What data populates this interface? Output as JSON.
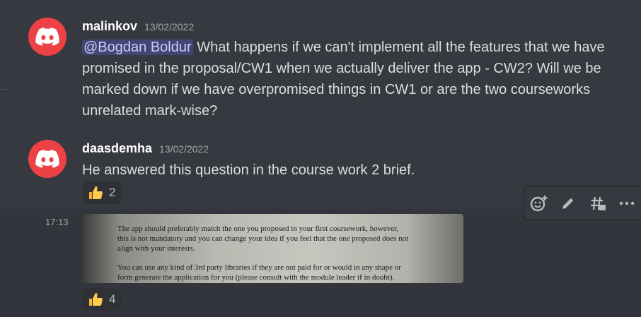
{
  "messages": [
    {
      "username": "malinkov",
      "timestamp": "13/02/2022",
      "mention": "@Bogdan Boldur",
      "text": "What happens if we can't implement all the features that we have promised in the proposal/CW1 when we actually deliver the app - CW2? Will we be marked down if we have overpromised things in CW1 or are the two courseworks unrelated mark-wise?"
    },
    {
      "username": "daasdemha",
      "timestamp": "13/02/2022",
      "text": "He answered this question in the course work 2 brief.",
      "reaction": {
        "emoji": "thumbs-up",
        "count": "2"
      }
    },
    {
      "time": "17:13",
      "attachment_lines": [
        "The app should preferably match the one you proposed in your first coursework, however,",
        "this is not mandatory and you can change your idea if you feel that the one proposed does not",
        "align with your interests.",
        "You can use any kind of 3rd party libraries if they are not paid for or would in any shape or",
        "form generate the application for you (please consult with the module leader if in doubt)."
      ],
      "reaction": {
        "emoji": "thumbs-up",
        "count": "4"
      }
    }
  ],
  "toolbar": {
    "icons": [
      "add-reaction-icon",
      "edit-icon",
      "create-thread-icon",
      "more-icon"
    ]
  },
  "colors": {
    "background": "#36393f",
    "avatar": "#ed4245",
    "mention_bg": "#414675",
    "mention_text": "#c9cdfb"
  }
}
